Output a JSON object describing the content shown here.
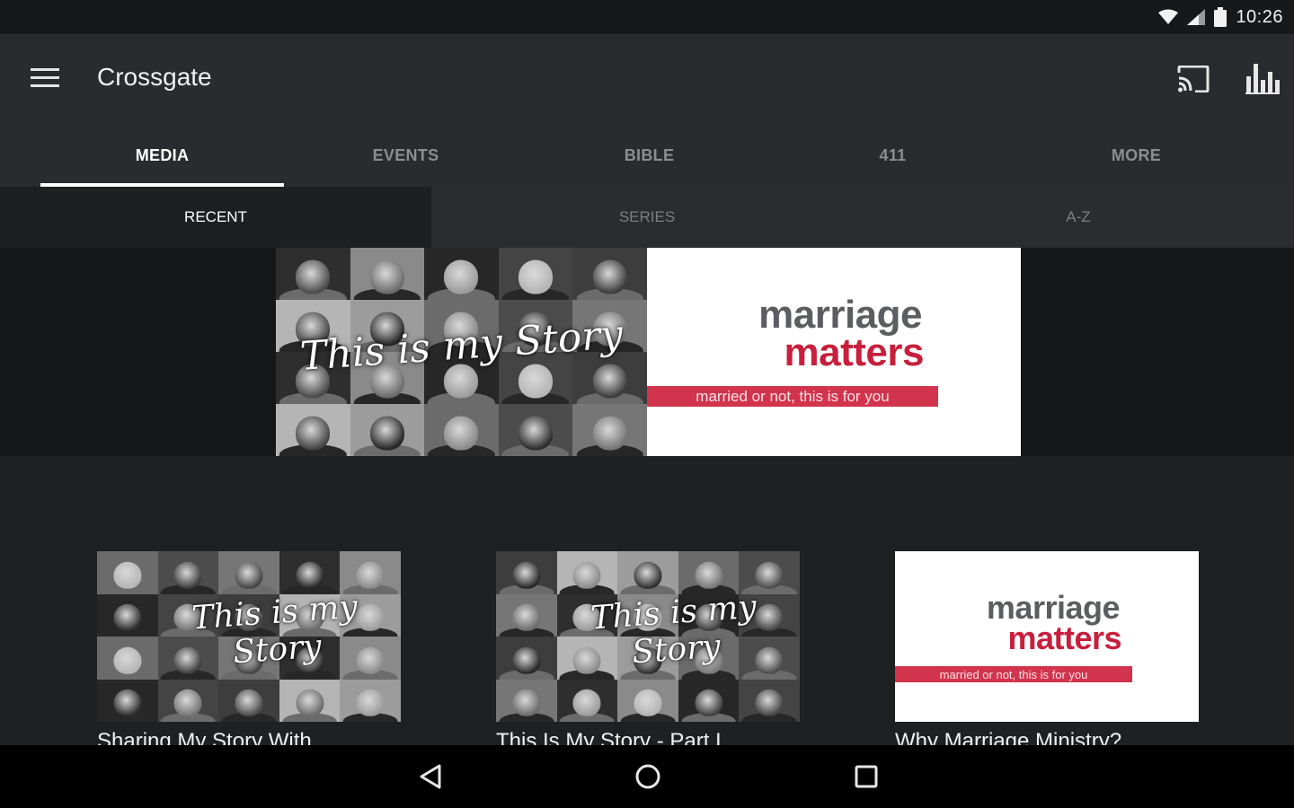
{
  "status": {
    "time": "10:26"
  },
  "app_bar": {
    "title": "Crossgate",
    "icons": [
      "menu-icon",
      "cast-icon",
      "bar-chart-icon"
    ]
  },
  "main_tabs": [
    {
      "label": "MEDIA",
      "active": true
    },
    {
      "label": "EVENTS",
      "active": false
    },
    {
      "label": "BIBLE",
      "active": false
    },
    {
      "label": "411",
      "active": false
    },
    {
      "label": "MORE",
      "active": false
    }
  ],
  "sub_tabs": [
    {
      "label": "RECENT",
      "active": true
    },
    {
      "label": "SERIES",
      "active": false
    },
    {
      "label": "A-Z",
      "active": false
    }
  ],
  "hero": {
    "story_script": "This is my Story",
    "mm_line1": "marriage",
    "mm_line2": "matters",
    "mm_tagline": "married or not, this is for you"
  },
  "cards": [
    {
      "title": "Sharing My Story With",
      "thumb": "story",
      "script": "This is my Story"
    },
    {
      "title": "This Is My Story - Part I",
      "thumb": "story",
      "script": "This is my Story"
    },
    {
      "title": "Why Marriage Ministry?",
      "thumb": "marriage",
      "mm_line1": "marriage",
      "mm_line2": "matters",
      "mm_tagline": "married or not, this is for you"
    }
  ],
  "colors": {
    "accent_red": "#c81f3c",
    "app_bar": "#2a2b2e",
    "background": "#1f2022"
  }
}
